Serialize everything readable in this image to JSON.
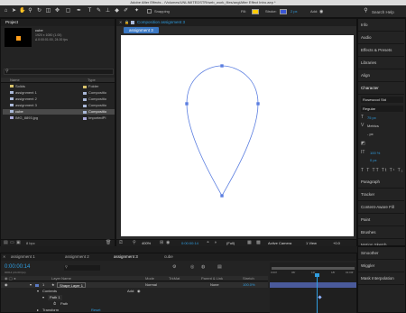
{
  "titlebar": {
    "title": "Adobe After Effects - /Volumes/UNLIMITEDSTR/web_work_files/anglAfter Effect Intro.aep *"
  },
  "toolbar": {
    "snapping_label": "Snapping",
    "fill_label": "Fill:",
    "stroke_label": "Stroke:",
    "stroke_value": "2 px",
    "add_label": "Add:",
    "search_placeholder": "Search Help"
  },
  "project": {
    "tab_label": "Project",
    "item_name": "cube",
    "item_size": "1920 x 1080 (1.00)",
    "item_duration": "Δ 0:00:01:00, 24.00 fps",
    "search_placeholder": "",
    "col_name": "Name",
    "col_type": "Type",
    "items": [
      {
        "name": "Solids",
        "type": "Folder",
        "color": "#d8c26b"
      },
      {
        "name": "assignment 1",
        "type": "Compositio",
        "color": "#a9b8d8"
      },
      {
        "name": "assignment 2",
        "type": "Compositio",
        "color": "#a9b8d8"
      },
      {
        "name": "assignment 3",
        "type": "Compositio",
        "color": "#a9b8d8"
      },
      {
        "name": "cube",
        "type": "Compositio",
        "color": "#a9b8d8"
      },
      {
        "name": "IMG_8893.jpg",
        "type": "ImportedPl",
        "color": "#a9a9d8"
      }
    ],
    "bpc_label": "8 bpc"
  },
  "composition": {
    "panel_title": "Composition assignment 3",
    "tab_label": "assignment 3",
    "zoom_label": "400%",
    "timecode": "0:00:00:14",
    "resolution_label": "(Full)",
    "camera_label": "Active Camera",
    "view_label": "1 View",
    "offset_label": "+0.0"
  },
  "right_panel": {
    "sections": [
      "Info",
      "Audio",
      "Effects & Presets",
      "Libraries",
      "Align",
      "Character",
      "Paragraph",
      "Tracker",
      "Content-Aware Fill",
      "Paint",
      "Brushes",
      "Motion Sketch",
      "Smoother",
      "Wiggler",
      "Mask Interpolation"
    ],
    "font_name": "Rosewood Std",
    "font_style": "Regular",
    "font_size": "75 px",
    "kerning": "Metrics",
    "leading": "- px",
    "scale": "100 %",
    "baseline": "0 px",
    "tracking": "0"
  },
  "timeline": {
    "tabs": [
      "assignment 1",
      "assignment 2",
      "assignment 3",
      "cube"
    ],
    "timecode": "0:00:00:14",
    "timecode_sub": "00014 (24.00 fps)",
    "col_layer_name": "Layer Name",
    "col_mode": "Mode",
    "col_trkmat": "TrkMat",
    "col_parent": "Parent & Link",
    "col_stretch": "Stretch",
    "layer_number": "1",
    "layer_name": "Shape Layer 1",
    "layer_mode": "Normal",
    "layer_parent": "None",
    "layer_stretch": "100.0%",
    "contents_label": "Contents",
    "add_label": "Add:",
    "path_label": "Path 1",
    "path_sub_label": "Path",
    "transform_label": "Transform",
    "reset_label": "Reset",
    "ruler_ticks": [
      "0:00f",
      "06f",
      "12f",
      "18f",
      "01:00f"
    ]
  },
  "colors": {
    "accent": "#2f9de0",
    "path_stroke": "#5b7ee0",
    "layer_bar": "#4a5a9a"
  }
}
